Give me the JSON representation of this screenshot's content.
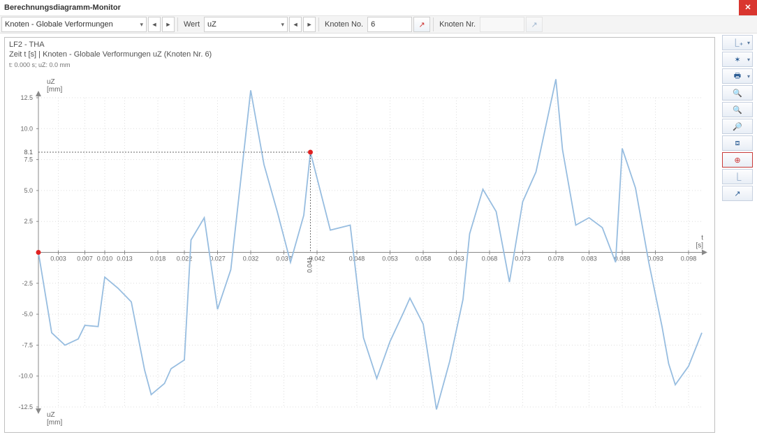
{
  "window": {
    "title": "Berechnungsdiagramm-Monitor"
  },
  "toolbar": {
    "combo1": {
      "value": "Knoten - Globale Verformungen"
    },
    "label_wert": "Wert",
    "combo2": {
      "value": "uZ"
    },
    "label_node_no": "Knoten No.",
    "node_no_value": "6",
    "label_node_nr": "Knoten Nr.",
    "node_nr_value": ""
  },
  "header": {
    "line1": "LF2 - THA",
    "line2": "Zeit t [s] | Knoten - Globale Verformungen uZ (Knoten Nr. 6)",
    "line3": "t: 0.000 s; uZ: 0.0 mm"
  },
  "axes": {
    "yunit_top": "uZ\n[mm]",
    "yunit_bottom": "uZ\n[mm]",
    "xunit": "t\n[s]",
    "pick_y_label": "8.1",
    "pick_x_label": "0.041"
  },
  "sidebar_icons": [
    {
      "name": "add-series-icon"
    },
    {
      "name": "axes-settings-icon"
    },
    {
      "name": "print-icon"
    },
    {
      "name": "zoom-extents-icon"
    },
    {
      "name": "zoom-in-icon"
    },
    {
      "name": "zoom-out-icon"
    },
    {
      "name": "zoom-window-icon"
    },
    {
      "name": "pick-point-icon"
    },
    {
      "name": "axes-linear-icon"
    },
    {
      "name": "axes-log-icon"
    }
  ],
  "chart_type": "line",
  "chart_data": {
    "type": "line",
    "title": "",
    "xlabel": "t [s]",
    "ylabel": "uZ [mm]",
    "xlim": [
      0,
      0.1
    ],
    "ylim": [
      -12.5,
      12.5
    ],
    "x_ticks": [
      0.003,
      0.007,
      0.01,
      0.013,
      0.018,
      0.022,
      0.027,
      0.032,
      0.037,
      0.042,
      0.048,
      0.053,
      0.058,
      0.063,
      0.068,
      0.073,
      0.078,
      0.083,
      0.088,
      0.093,
      0.098
    ],
    "y_ticks": [
      -12.5,
      -10.0,
      -7.5,
      -5.0,
      -2.5,
      2.5,
      5.0,
      7.5,
      10.0,
      12.5
    ],
    "marker": {
      "x": 0.041,
      "y": 8.1
    },
    "series": [
      {
        "name": "uZ (Knoten Nr. 6)",
        "color": "#97bde0",
        "x": [
          0.0,
          0.002,
          0.004,
          0.006,
          0.007,
          0.009,
          0.01,
          0.012,
          0.014,
          0.016,
          0.017,
          0.019,
          0.02,
          0.022,
          0.023,
          0.025,
          0.027,
          0.029,
          0.032,
          0.034,
          0.036,
          0.038,
          0.04,
          0.041,
          0.044,
          0.047,
          0.049,
          0.051,
          0.053,
          0.055,
          0.056,
          0.058,
          0.06,
          0.062,
          0.064,
          0.065,
          0.067,
          0.069,
          0.071,
          0.073,
          0.075,
          0.077,
          0.078,
          0.079,
          0.081,
          0.083,
          0.085,
          0.087,
          0.088,
          0.09,
          0.092,
          0.094,
          0.095,
          0.096,
          0.098,
          0.1
        ],
        "values": [
          0.0,
          -6.5,
          -7.5,
          -7.0,
          -5.9,
          -6.0,
          -2.0,
          -2.9,
          -4.0,
          -9.5,
          -11.5,
          -10.6,
          -9.4,
          -8.7,
          1.0,
          2.8,
          -4.6,
          -1.4,
          13.1,
          7.1,
          3.3,
          -0.8,
          3.0,
          8.1,
          1.8,
          2.2,
          -6.9,
          -10.2,
          -7.2,
          -4.9,
          -3.7,
          -5.8,
          -12.7,
          -8.8,
          -3.8,
          1.5,
          5.1,
          3.3,
          -2.4,
          4.1,
          6.5,
          11.5,
          14.0,
          8.3,
          2.2,
          2.8,
          2.0,
          -0.8,
          8.4,
          5.2,
          -0.8,
          -6.0,
          -9.0,
          -10.7,
          -9.2,
          -6.5
        ]
      }
    ]
  }
}
